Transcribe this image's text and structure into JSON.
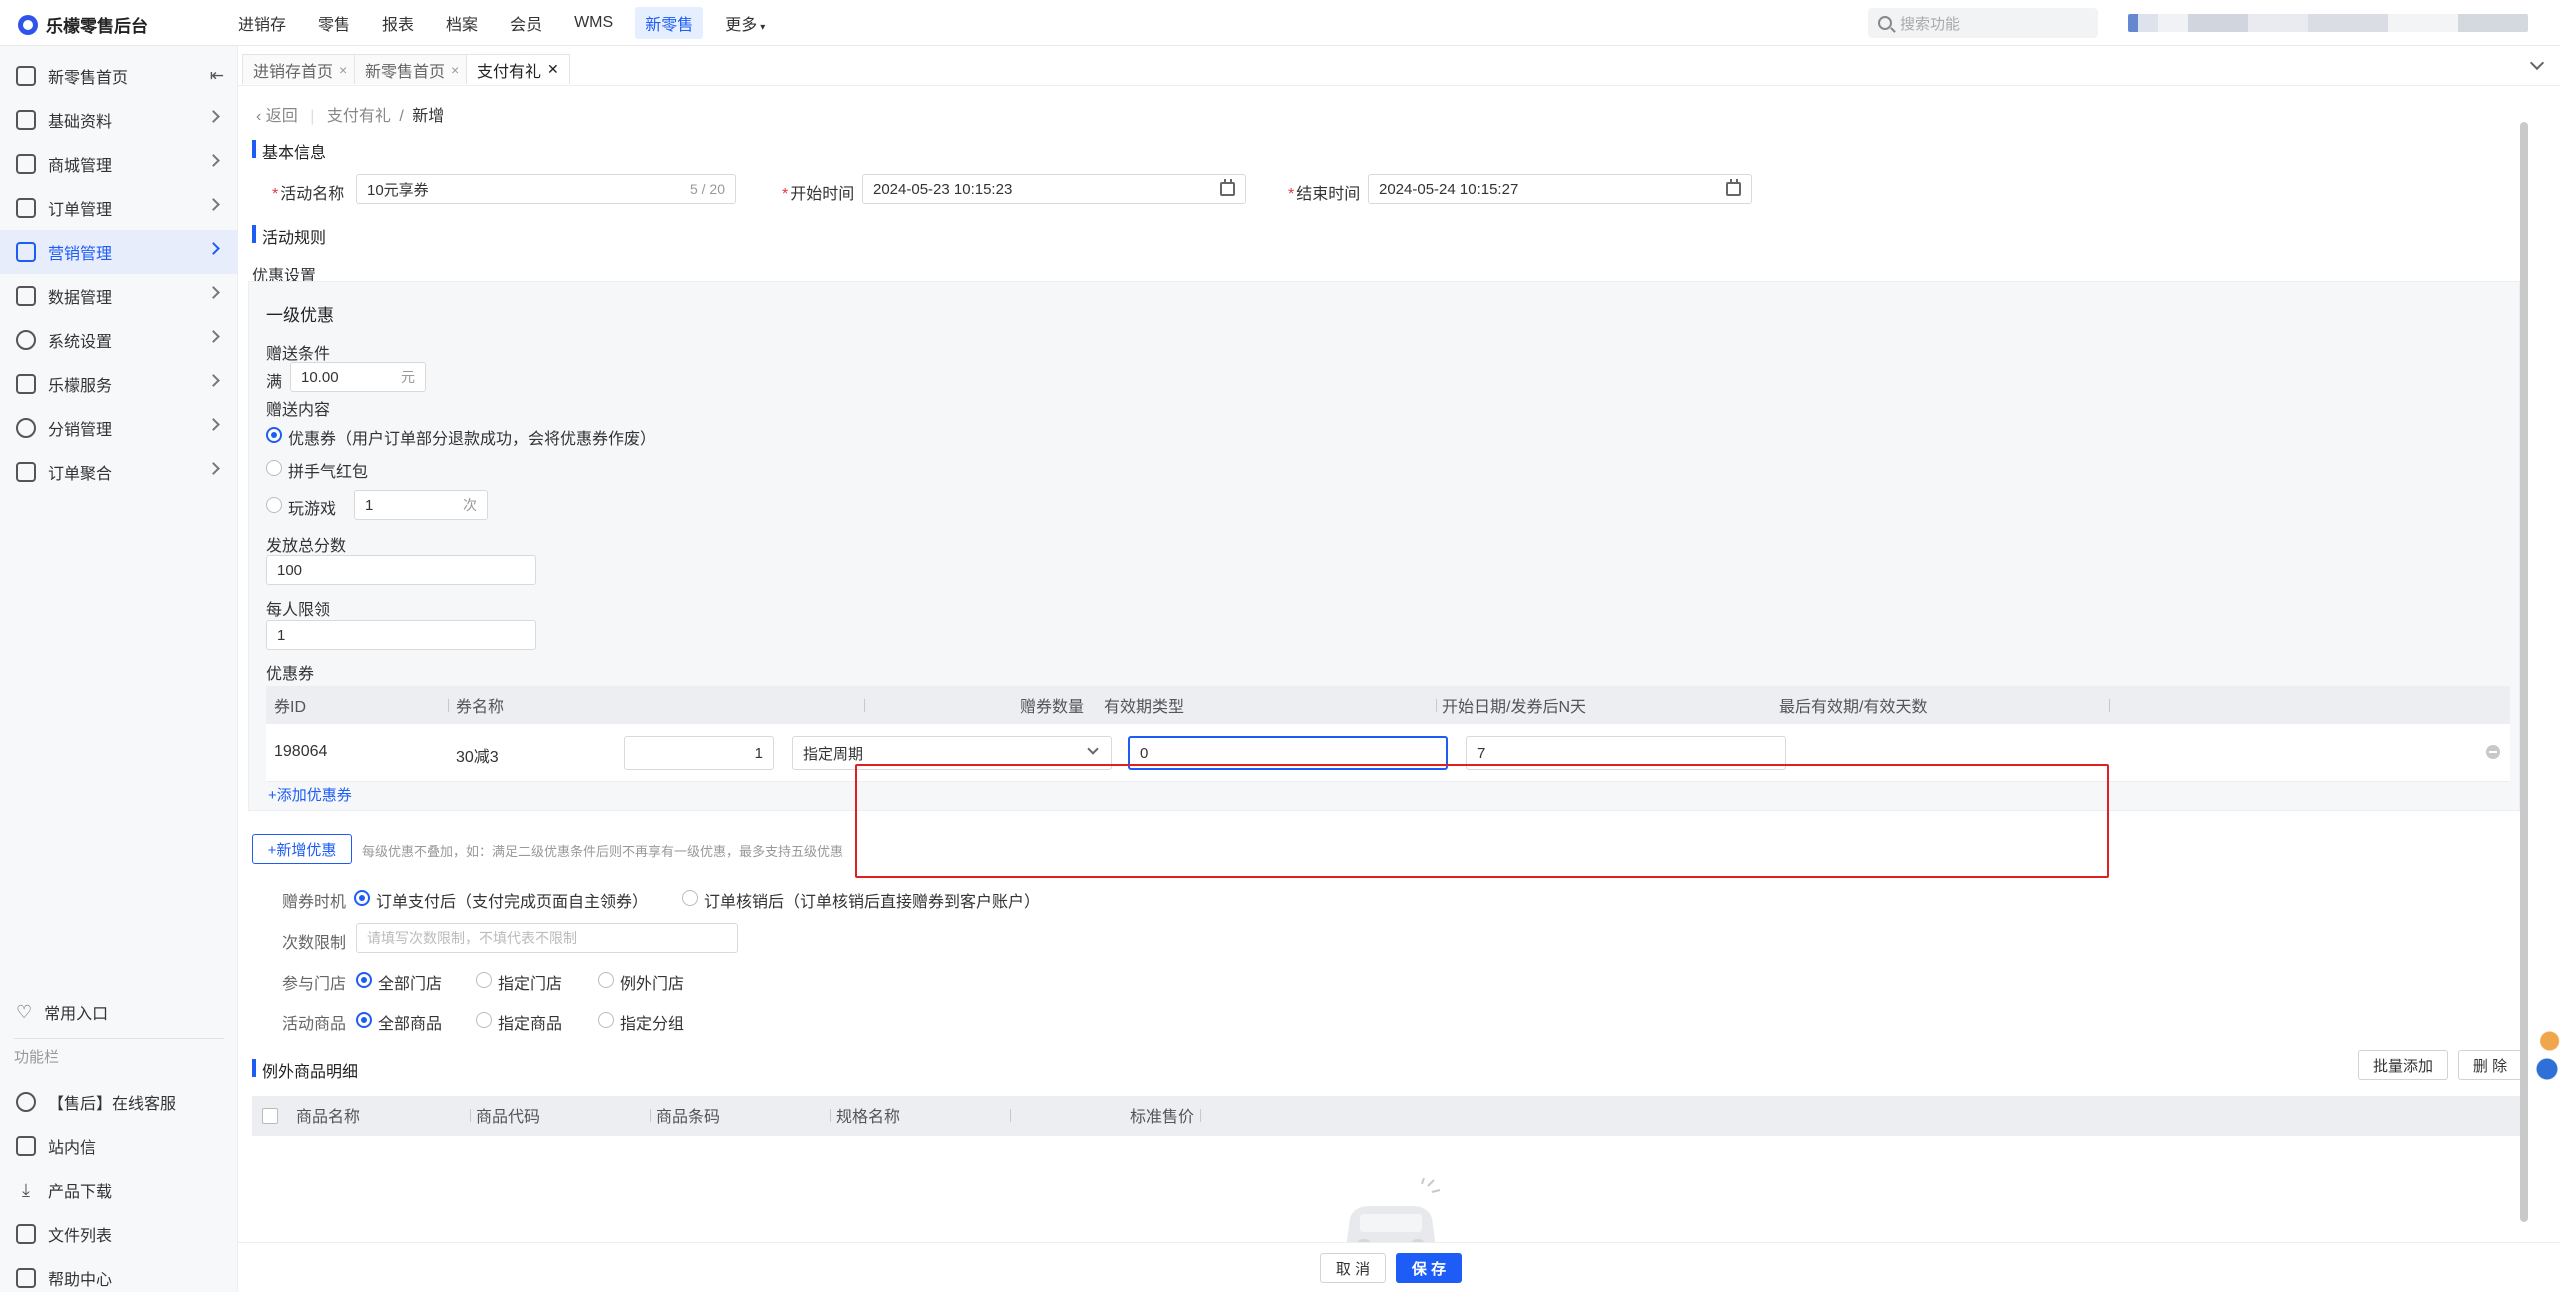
{
  "app": {
    "title": "乐檬零售后台"
  },
  "topnav": [
    "进销存",
    "零售",
    "报表",
    "档案",
    "会员",
    "WMS",
    "新零售",
    "更多"
  ],
  "search": {
    "placeholder": "搜索功能"
  },
  "sidebar": {
    "items": [
      "新零售首页",
      "基础资料",
      "商城管理",
      "订单管理",
      "营销管理",
      "数据管理",
      "系统设置",
      "乐檬服务",
      "分销管理",
      "订单聚合"
    ],
    "common_entry": "常用入口",
    "section_title": "功能栏",
    "func_items": [
      "【售后】在线客服",
      "站内信",
      "产品下载",
      "文件列表",
      "帮助中心"
    ]
  },
  "tabs": [
    {
      "label": "进销存首页",
      "close": "×"
    },
    {
      "label": "新零售首页",
      "close": "×"
    },
    {
      "label": "支付有礼",
      "close": "✕"
    }
  ],
  "breadcrumb": {
    "back": "返回",
    "parent": "支付有礼",
    "sep": "/",
    "current": "新增"
  },
  "basic": {
    "title": "基本信息",
    "name_label": "活动名称",
    "name_value": "10元享券",
    "name_count": "5 / 20",
    "start_label": "开始时间",
    "start_value": "2024-05-23 10:15:23",
    "end_label": "结束时间",
    "end_value": "2024-05-24 10:15:27"
  },
  "rules": {
    "title": "活动规则",
    "discount_setting": "优惠设置",
    "level_title": "一级优惠",
    "gift_condition": "赠送条件",
    "full_prefix": "满",
    "full_value": "10.00",
    "full_unit": "元",
    "gift_content": "赠送内容",
    "opt_coupon": "优惠券（用户订单部分退款成功，会将优惠券作废）",
    "opt_redpacket": "拼手气红包",
    "opt_game": "玩游戏",
    "game_value": "1",
    "game_unit": "次",
    "total_label": "发放总分数",
    "total_value": "100",
    "per_label": "每人限领",
    "per_value": "1",
    "coupon_label": "优惠券",
    "table_headers": [
      "券ID",
      "券名称",
      "赠券数量",
      "有效期类型",
      "开始日期/发券后N天",
      "最后有效期/有效天数"
    ],
    "rows": [
      {
        "id": "198064",
        "name": "30减3",
        "qty": "1",
        "type": "指定周期",
        "start": "0",
        "end": "7"
      }
    ],
    "add_coupon": "+添加优惠券",
    "add_discount": "+新增优惠",
    "add_discount_tip": "每级优惠不叠加，如：满足二级优惠条件后则不再享有一级优惠，最多支持五级优惠"
  },
  "options": {
    "timing_label": "赠券时机",
    "timing_a": "订单支付后（支付完成页面自主领券）",
    "timing_b": "订单核销后（订单核销后直接赠券到客户账户）",
    "limit_label": "次数限制",
    "limit_placeholder": "请填写次数限制，不填代表不限制",
    "store_label": "参与门店",
    "store_opts": [
      "全部门店",
      "指定门店",
      "例外门店"
    ],
    "goods_label": "活动商品",
    "goods_opts": [
      "全部商品",
      "指定商品",
      "指定分组"
    ]
  },
  "exceptions": {
    "title": "例外商品明细",
    "batch_add": "批量添加",
    "delete": "删 除",
    "headers": [
      "商品名称",
      "商品代码",
      "商品条码",
      "规格名称",
      "标准售价"
    ]
  },
  "footer": {
    "cancel": "取 消",
    "save": "保 存"
  },
  "colors": {
    "accent": "#1d5cf6",
    "highlight": "#e02020"
  }
}
